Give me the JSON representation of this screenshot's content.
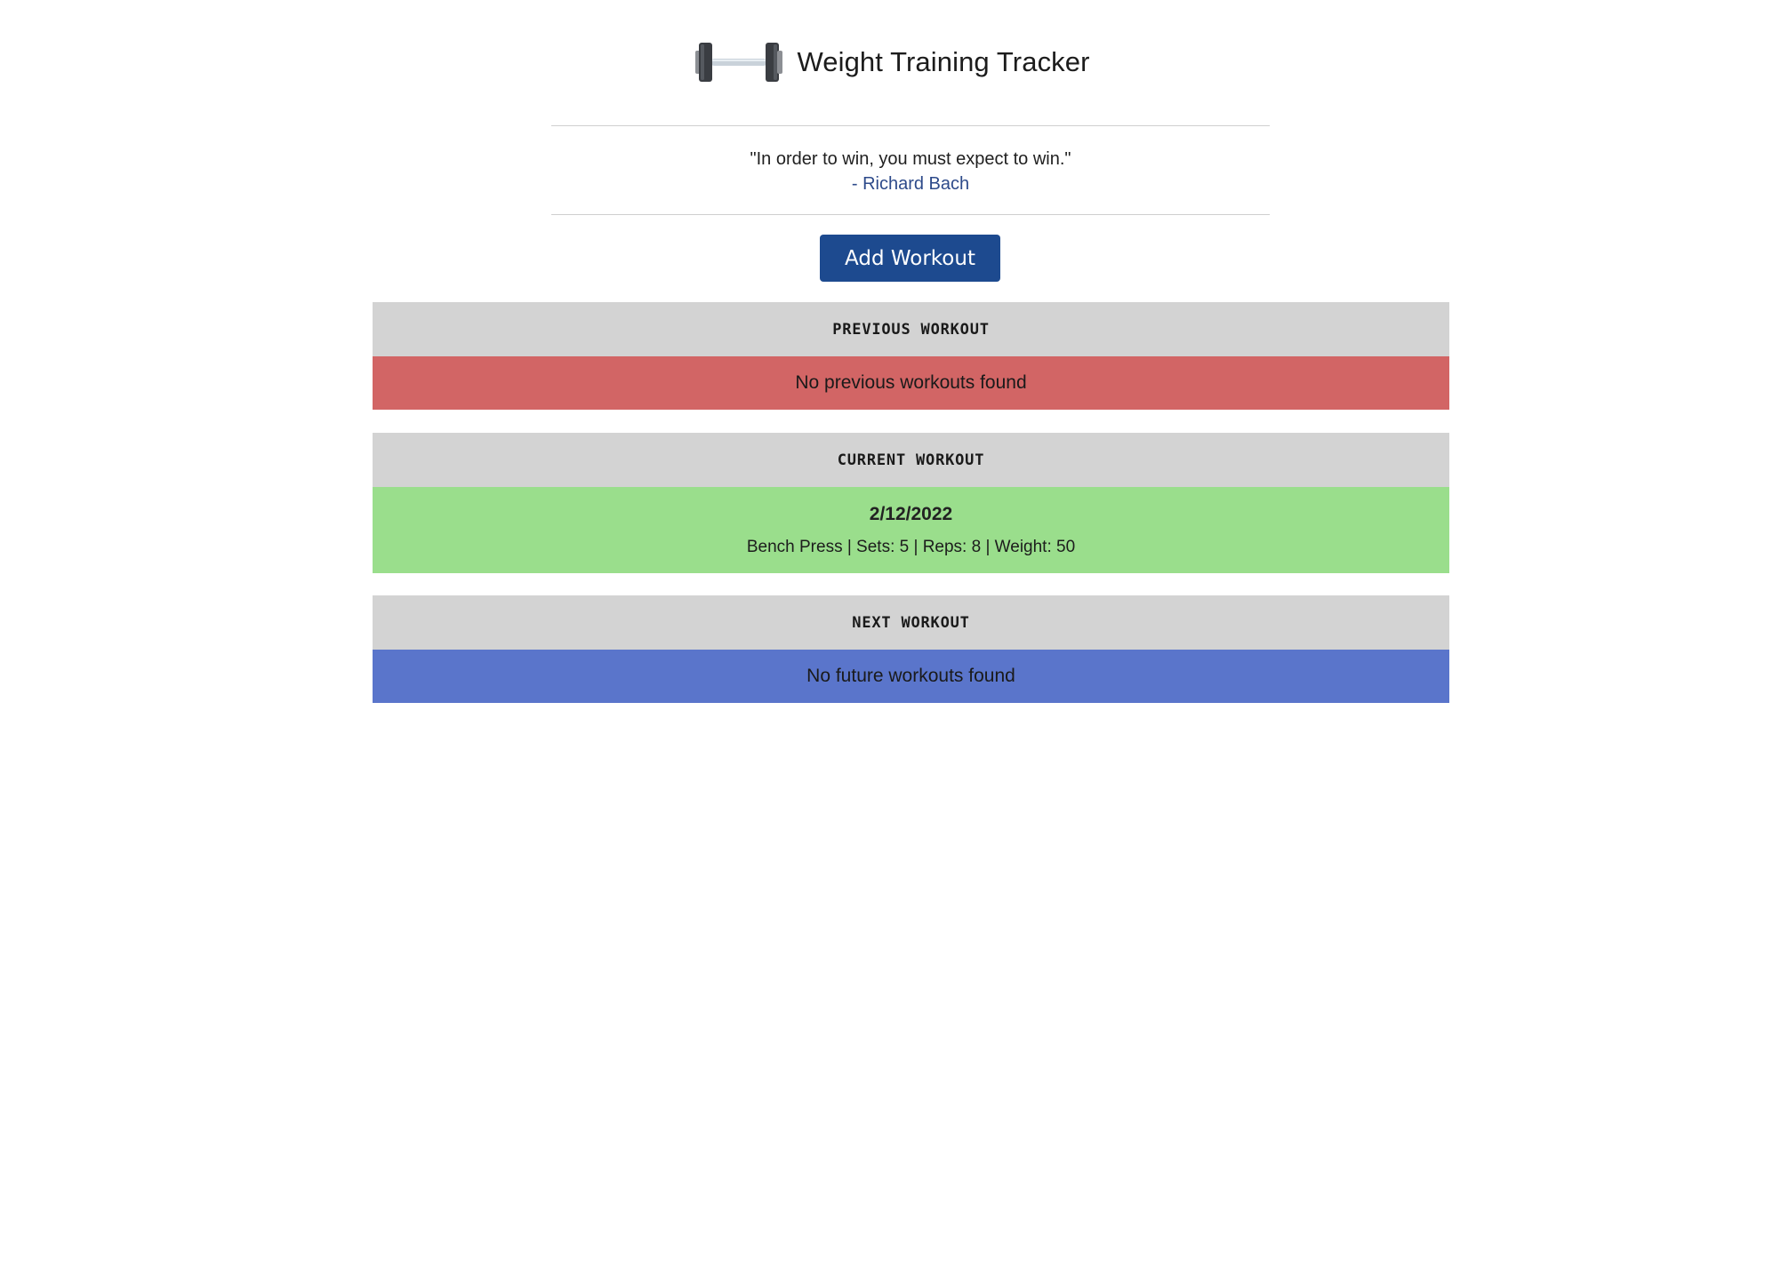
{
  "app": {
    "title": "Weight Training Tracker",
    "logo_icon": "dumbbell-icon"
  },
  "quote": {
    "text": "\"In order to win, you must expect to win.\"",
    "dash": "- ",
    "author": "Richard Bach"
  },
  "actions": {
    "add_workout_label": "Add Workout"
  },
  "sections": {
    "previous": {
      "heading": "PREVIOUS WORKOUT",
      "message": "No previous workouts found",
      "color": "#d26565"
    },
    "current": {
      "heading": "CURRENT WORKOUT",
      "date": "2/12/2022",
      "entries": [
        "Bench Press | Sets: 5 | Reps: 8 | Weight: 50"
      ],
      "color": "#9ade8c"
    },
    "next": {
      "heading": "NEXT WORKOUT",
      "message": "No future workouts found",
      "color": "#5a75cb"
    }
  },
  "colors": {
    "section_header": "#d3d3d3",
    "button": "#1d4a8f",
    "author_link": "#2d4a8a"
  }
}
